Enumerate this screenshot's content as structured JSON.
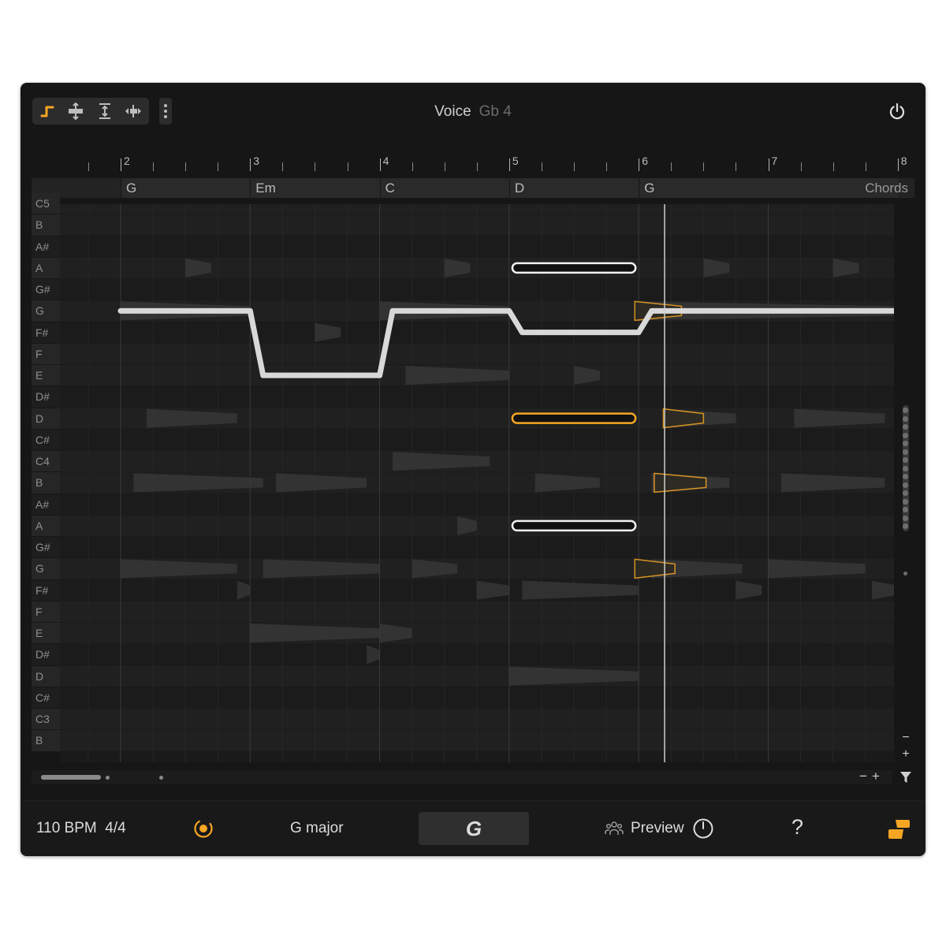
{
  "header": {
    "voice_label": "Voice",
    "voice_note": "Gb 4",
    "tools": [
      {
        "name": "draw-tool",
        "active": true
      },
      {
        "name": "split-tool",
        "active": false
      },
      {
        "name": "resize-tool",
        "active": false
      },
      {
        "name": "stretch-tool",
        "active": false
      }
    ]
  },
  "ruler": {
    "bars": [
      "2",
      "3",
      "4",
      "5",
      "6",
      "7",
      "8"
    ]
  },
  "chords": {
    "items": [
      {
        "label": "G",
        "start": 2,
        "end": 3
      },
      {
        "label": "Em",
        "start": 3,
        "end": 4
      },
      {
        "label": "C",
        "start": 4,
        "end": 5
      },
      {
        "label": "D",
        "start": 5,
        "end": 6
      },
      {
        "label": "G",
        "start": 6,
        "end": 8
      }
    ],
    "lane_label": "Chords"
  },
  "keys": [
    "C5",
    "B",
    "A#",
    "A",
    "G#",
    "G",
    "F#",
    "F",
    "E",
    "D#",
    "D",
    "C#",
    "C4",
    "B",
    "A#",
    "A",
    "G#",
    "G",
    "F#",
    "F",
    "E",
    "D#",
    "D",
    "C#",
    "C3",
    "B"
  ],
  "accent_color": "#f5a623",
  "voice_line": {
    "points": [
      {
        "beat": 2.0,
        "note": "G4"
      },
      {
        "beat": 3.0,
        "note": "G4"
      },
      {
        "beat": 3.1,
        "note": "E4"
      },
      {
        "beat": 4.0,
        "note": "E4"
      },
      {
        "beat": 4.1,
        "note": "G4"
      },
      {
        "beat": 5.0,
        "note": "G4"
      },
      {
        "beat": 5.1,
        "note": "F#4"
      },
      {
        "beat": 6.0,
        "note": "F#4"
      },
      {
        "beat": 6.1,
        "note": "G4"
      },
      {
        "beat": 8.0,
        "note": "G4"
      }
    ]
  },
  "highlighted_notes": [
    {
      "note": "A4",
      "start": 5.0,
      "end": 6.0,
      "style": "white"
    },
    {
      "note": "D4",
      "start": 5.0,
      "end": 6.0,
      "style": "orange"
    },
    {
      "note": "A3",
      "start": 5.0,
      "end": 6.0,
      "style": "white"
    }
  ],
  "footer": {
    "tempo": "110 BPM  4/4",
    "key": "G major",
    "chord_button": "G",
    "preview": "Preview",
    "help": "?"
  }
}
